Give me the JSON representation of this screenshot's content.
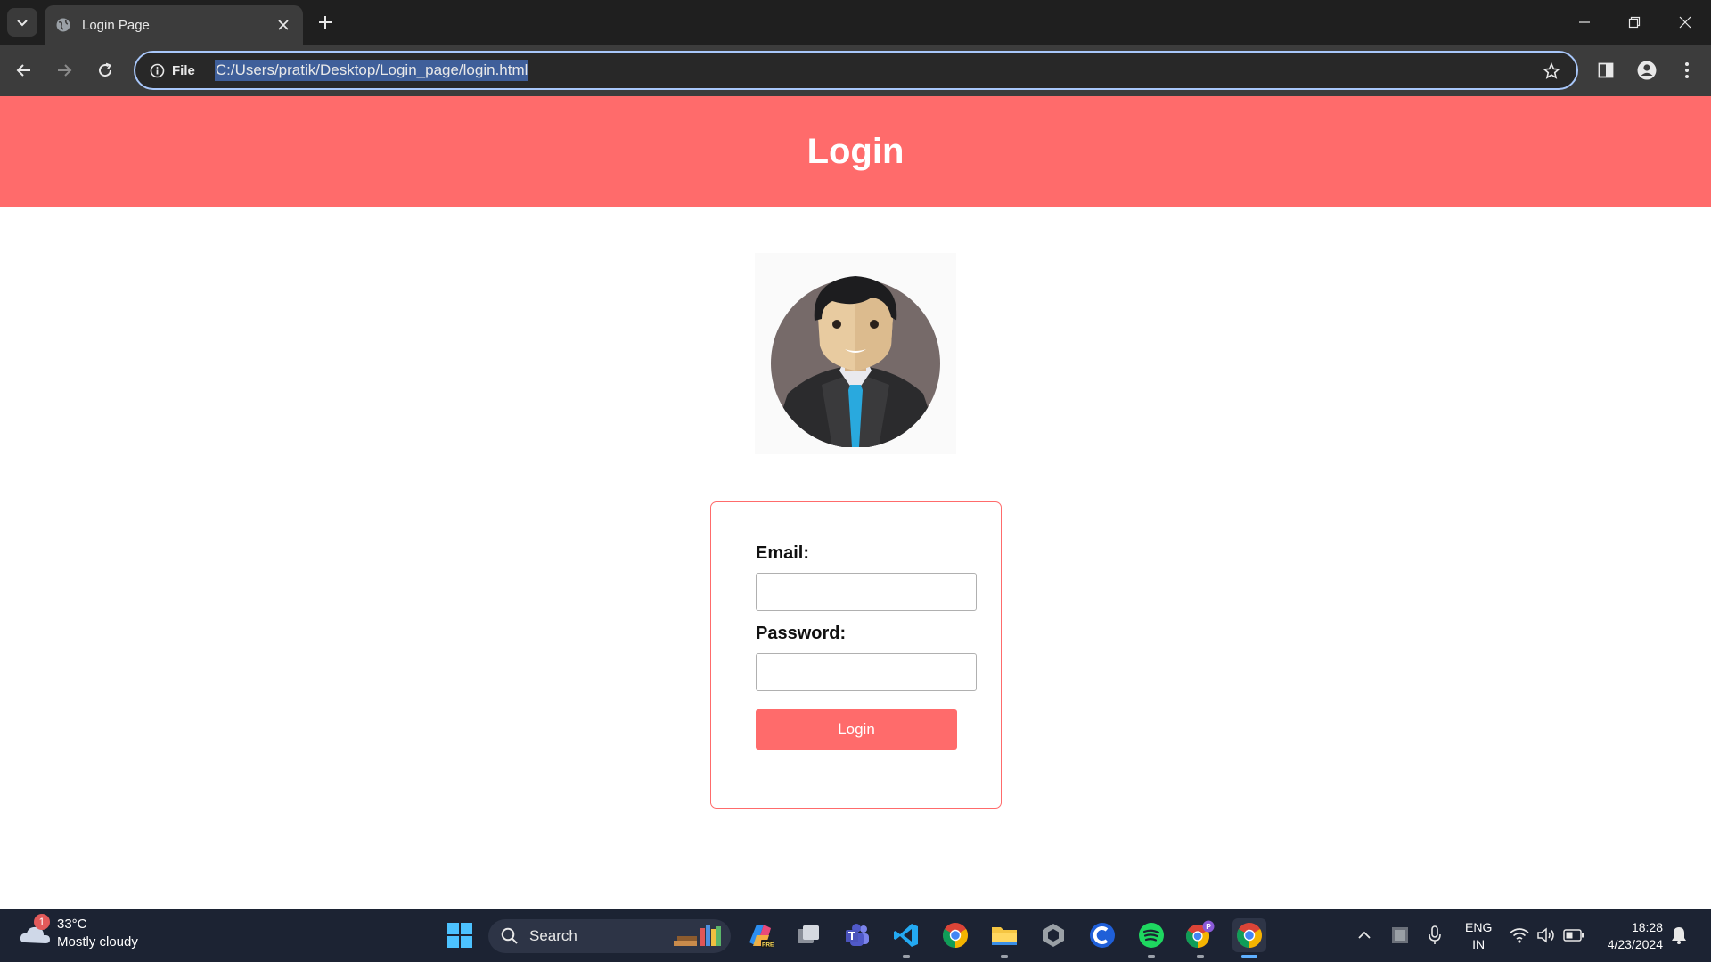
{
  "browser": {
    "tab_title": "Login Page",
    "omnibox_label": "File",
    "url": "C:/Users/pratik/Desktop/Login_page/login.html"
  },
  "page": {
    "header_title": "Login",
    "email_label": "Email:",
    "email_value": "",
    "password_label": "Password:",
    "password_value": "",
    "login_button": "Login",
    "colors": {
      "accent": "#ff6b6b"
    }
  },
  "taskbar": {
    "weather_badge": "1",
    "weather_temp": "33°C",
    "weather_condition": "Mostly cloudy",
    "search_label": "Search",
    "lang_line1": "ENG",
    "lang_line2": "IN",
    "time": "18:28",
    "date": "4/23/2024",
    "pinned_apps": [
      "windows-start",
      "search",
      "copilot",
      "task-view",
      "teams",
      "vscode",
      "chrome",
      "file-explorer",
      "unity",
      "ccleaner",
      "spotify",
      "chrome-profile",
      "chrome-active"
    ]
  }
}
